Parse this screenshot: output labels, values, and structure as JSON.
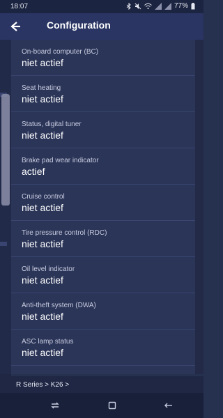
{
  "status": {
    "time": "18:07",
    "battery": "77%"
  },
  "app_bar": {
    "title": "Configuration"
  },
  "items": [
    {
      "label": "On-board computer (BC)",
      "value": "niet actief"
    },
    {
      "label": "Seat heating",
      "value": "niet actief"
    },
    {
      "label": "Status, digital tuner",
      "value": "niet actief"
    },
    {
      "label": "Brake pad wear indicator",
      "value": "actief"
    },
    {
      "label": "Cruise control",
      "value": "niet actief"
    },
    {
      "label": "Tire pressure control (RDC)",
      "value": "niet actief"
    },
    {
      "label": "Oil level indicator",
      "value": "niet actief"
    },
    {
      "label": "Anti-theft system (DWA)",
      "value": "niet actief"
    },
    {
      "label": "ASC lamp status",
      "value": "niet actief"
    }
  ],
  "breadcrumb": "R Series > K26 >",
  "icons": {
    "back": "back-arrow-icon",
    "recents": "recent-apps-icon",
    "home": "home-icon",
    "nav_back": "back-icon"
  },
  "colors": {
    "background": "#26304f",
    "app_bar": "#2a3563",
    "list": "#2b3558"
  }
}
